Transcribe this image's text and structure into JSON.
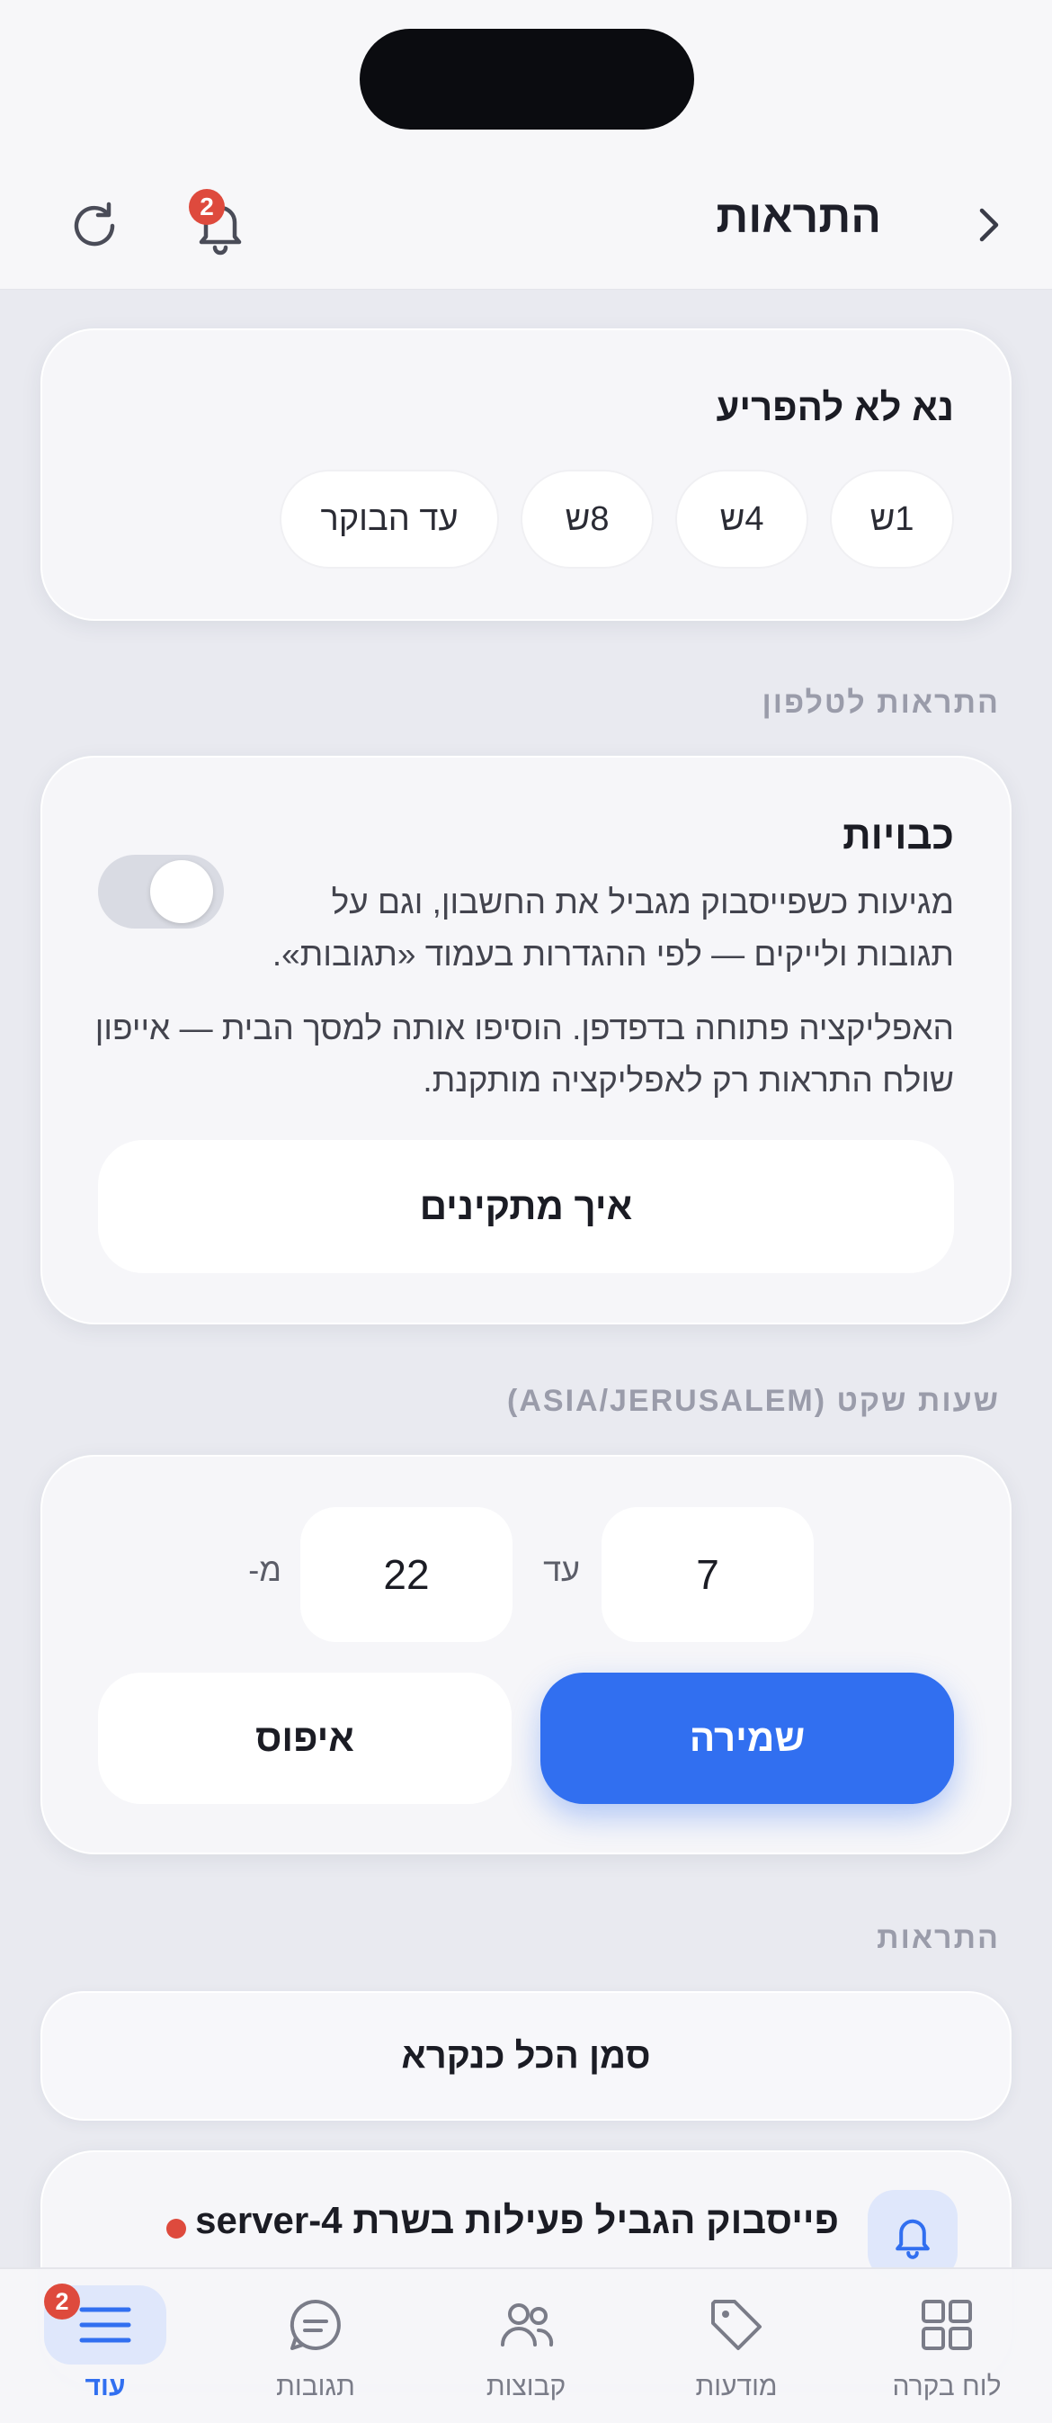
{
  "header": {
    "title": "התראות",
    "bell_badge": "2"
  },
  "dnd": {
    "title": "נא לא להפריע",
    "chips": [
      "1ש",
      "4ש",
      "8ש",
      "עד הבוקר"
    ]
  },
  "push": {
    "section_label": "התראות לטלפון",
    "title": "כבויות",
    "description": "מגיעות כשפייסבוק מגביל את החשבון, וגם על תגובות ולייקים — לפי ההגדרות בעמוד «תגובות».",
    "note": "האפליקציה פתוחה בדפדפן. הוסיפו אותה למסך הבית — אייפון שולח התראות רק לאפליקציה מותקנת.",
    "toggle_on": false,
    "install_label": "איך מתקינים"
  },
  "quiet": {
    "section_label": "שעות שקט (ASIA/JERUSALEM)",
    "from_label": "מ-",
    "from_value": "22",
    "to_label": "עד",
    "to_value": "7",
    "save_label": "שמירה",
    "reset_label": "איפוס"
  },
  "notifications": {
    "section_label": "התראות",
    "mark_all_label": "סמן הכל כנקרא",
    "items": [
      {
        "title": "פייסבוק הגביל פעילות בשרת server-4",
        "unread": true
      }
    ]
  },
  "nav": {
    "items": [
      {
        "label": "לוח בקרה",
        "icon": "dashboard-icon"
      },
      {
        "label": "מודעות",
        "icon": "tag-icon"
      },
      {
        "label": "קבוצות",
        "icon": "users-icon"
      },
      {
        "label": "תגובות",
        "icon": "chat-icon"
      },
      {
        "label": "עוד",
        "icon": "menu-icon",
        "badge": "2",
        "active": true
      }
    ]
  },
  "colors": {
    "accent": "#316ff0",
    "badge": "#de4a3d",
    "background": "#e9eaf0"
  }
}
